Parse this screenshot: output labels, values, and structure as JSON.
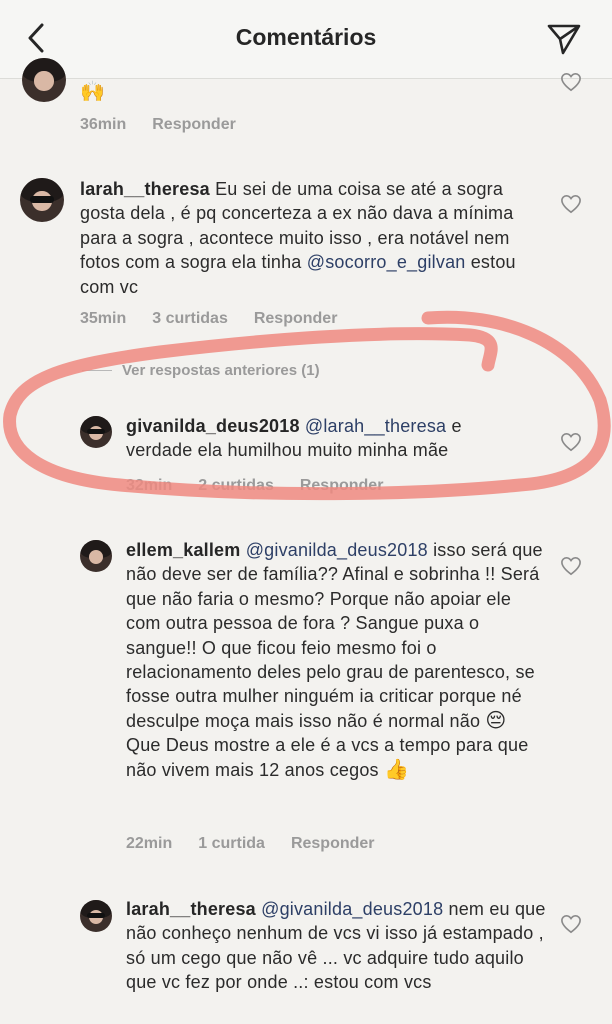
{
  "header": {
    "title": "Comentários",
    "back_icon": "chevron-left-icon",
    "send_icon": "paper-plane-icon"
  },
  "comments": [
    {
      "emoji": "🙌",
      "time": "36min",
      "reply": "Responder"
    },
    {
      "username": "larah__theresa",
      "text_a": " Eu sei de uma coisa se até a sogra gosta dela , é pq concerteza a ex não dava a mínima para a sogra , acontece muito isso , era notável nem fotos com a sogra ela tinha ",
      "mention": "@socorro_e_gilvan",
      "text_b": " estou com vc",
      "time": "35min",
      "likes": "3 curtidas",
      "reply": "Responder"
    },
    {
      "view_previous": "Ver respostas anteriores (1)"
    },
    {
      "username": "givanilda_deus2018",
      "mention": "@larah__theresa",
      "text_b": " e verdade ela humilhou muito minha mãe",
      "time": "32min",
      "likes": "2 curtidas",
      "reply": "Responder"
    },
    {
      "username": "ellem_kallem",
      "mention": "@givanilda_deus2018",
      "text_b": " isso será que não deve ser de família?? Afinal e sobrinha !! Será que não faria o mesmo? Porque não apoiar ele com outra pessoa de fora ? Sangue puxa o sangue!! O que ficou feio mesmo foi o relacionamento deles pelo grau de parentesco, se fosse outra mulher ninguém ia criticar porque né desculpe moça mais isso não é normal não ",
      "emoji1": "😔",
      "text_c": " Que Deus mostre a ele é a vcs a tempo para que não vivem mais 12 anos cegos ",
      "emoji2": "👍",
      "time": "22min",
      "likes": "1 curtida",
      "reply": "Responder"
    },
    {
      "username": "larah__theresa",
      "mention": "@givanilda_deus2018",
      "text_b": " nem eu que não conheço nenhum de vcs vi isso já estampado , só um cego que não vê ... vc adquire tudo aquilo que vc fez por onde ..: estou com vcs"
    }
  ],
  "colors": {
    "highlight_circle": "#ef8a80",
    "mention": "#2d3f66",
    "meta": "#9a9a9a"
  }
}
